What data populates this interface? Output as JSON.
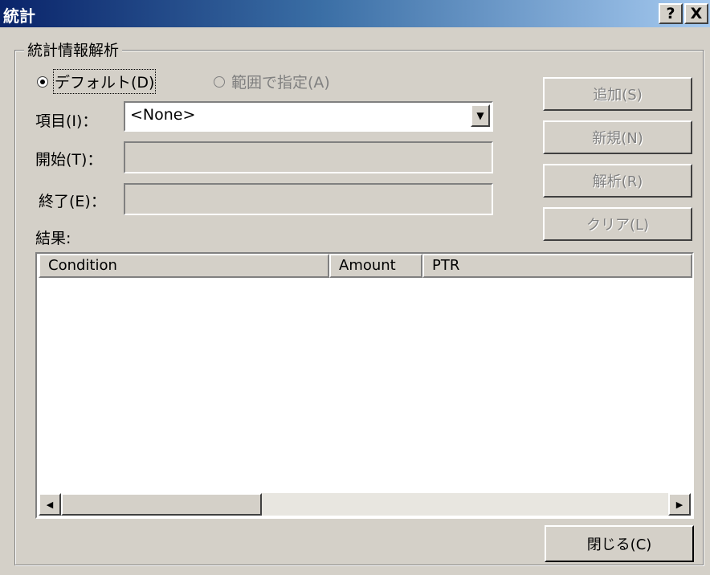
{
  "window": {
    "title": "統計",
    "help_button": "?",
    "close_button": "X"
  },
  "group": {
    "label": "統計情報解析"
  },
  "radios": [
    {
      "label": "デフォルト(D)",
      "selected": true,
      "enabled": true
    },
    {
      "label": "範囲で指定(A)",
      "selected": false,
      "enabled": false
    }
  ],
  "fields": {
    "item_label": "項目(I)：",
    "item_value": "<None>",
    "start_label": "開始(T)：",
    "start_value": "",
    "end_label": "終了(E)：",
    "end_value": ""
  },
  "buttons": {
    "add": "追加(S)",
    "new": "新規(N)",
    "analyze": "解析(R)",
    "clear": "クリア(L)",
    "close": "閉じる(C)"
  },
  "results": {
    "label": "結果:",
    "columns": [
      "Condition",
      "Amount",
      "PTR"
    ],
    "rows": []
  },
  "icons": {
    "dropdown": "chevron-down-icon",
    "scroll_left": "arrow-left-icon",
    "scroll_right": "arrow-right-icon"
  }
}
